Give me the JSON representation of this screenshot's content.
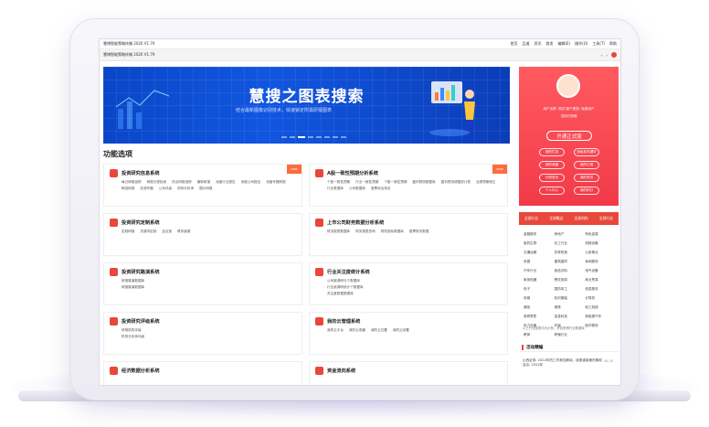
{
  "window": {
    "title": "慧博智能策略终端 2020 V1.79",
    "subtitle": "慧博智能策略终端 2020 V1.79"
  },
  "menubar": {
    "items": [
      "首页",
      "品道",
      "资讯",
      "首发",
      "编辑(E)",
      "操作(O)",
      "工具(T)",
      "帮助"
    ]
  },
  "banner": {
    "title": "慧搜之图表搜索",
    "subtitle": "结合最新图像识别技术，快速锁定所需研报图表"
  },
  "section": {
    "title": "功能选项"
  },
  "cards": [
    {
      "title": "投资研究信息系统",
      "badge": "new",
      "links": [
        "每日研报追踪",
        "研报分类检索",
        "热点研报追踪",
        "最新研报",
        "深度行业报告",
        "深度公司报告",
        "深度专题研报",
        "精选研报",
        "宏观专题",
        "公司评级",
        "机构分析师",
        "图片研报"
      ]
    },
    {
      "title": "A股一致性预期分析系统",
      "badge": "new",
      "links": [
        "个股一致性预期",
        "行业一致性预期",
        "个股一致性预期",
        "盈利预测数据库",
        "盈利预测调整统计表",
        "业绩预期修正",
        "行业数据库",
        "公司数据库",
        "股票综合排名"
      ]
    },
    {
      "title": "投资研究定制系统",
      "badge": "",
      "links": [
        "定制研报",
        "关键词定制",
        "会议室",
        "联系客服"
      ]
    },
    {
      "title": "上市公司财务数据分析系统",
      "badge": "",
      "links": [
        "财务报表数据库",
        "财务报表查询",
        "财务指标数据库",
        "股票财务数据"
      ]
    },
    {
      "title": "投资研究路演系统",
      "badge": "",
      "links": [
        "研报路演数据库",
        "研报路演数据库"
      ]
    },
    {
      "title": "行业关注度统计系统",
      "badge": "",
      "links": [
        "公司被调研与个数据库",
        "行业被调研统计个数据库",
        "关注度数据数据库"
      ]
    },
    {
      "title": "投资研究评级系统",
      "badge": "",
      "links": [
        "研报机构评级",
        "机构分析师评级"
      ]
    },
    {
      "title": "我的云管理系统",
      "badge": "",
      "links": [
        "我的云平台",
        "我的云收藏",
        "我的云位置",
        "我的云设置"
      ]
    },
    {
      "title": "经济数据分析系统",
      "badge": "",
      "links": []
    },
    {
      "title": "资金流向系统",
      "badge": "",
      "links": []
    }
  ],
  "user": {
    "line1": "用户名称: 测试  账户类型: 免费用户",
    "line2": "试用已到期",
    "upgrade_label": "开通正式版",
    "buttons": [
      "我的栏目",
      "添加到关键字",
      "我的收藏",
      "我的订阅",
      "行研资讯",
      "我的资讯",
      "个人中心",
      "我的积分"
    ]
  },
  "industry_tabs": [
    "全部行业",
    "全部概念",
    "全部机构",
    "全部行业"
  ],
  "industries": [
    "金融服务",
    "房地产",
    "有色金属",
    "医药生物",
    "化工行业",
    "机械设备",
    "交通运输",
    "农林牧渔",
    "公用事业",
    "采掘",
    "建筑建材",
    "休闲服务",
    "汽车行业",
    "食品饮料",
    "电气设备",
    "家用电器",
    "餐饮旅游",
    "商业贸易",
    "电子",
    "国防军工",
    "信息服务",
    "传媒",
    "纺织服装",
    "计算机",
    "通信",
    "钢铁",
    "轻工制造",
    "商贸零售",
    "信息科技",
    "新能源汽车",
    "电力设备",
    "环保",
    "医疗服务",
    "教育",
    "养殖行业"
  ],
  "industry_note": "以上行业图表均为示例，来自慧博行业数据库",
  "activity": {
    "title": "活动精编",
    "item": "山西证券: 2022年的工作报告解读，经报道增速的期权会议: 2022年",
    "date": "08-28"
  }
}
